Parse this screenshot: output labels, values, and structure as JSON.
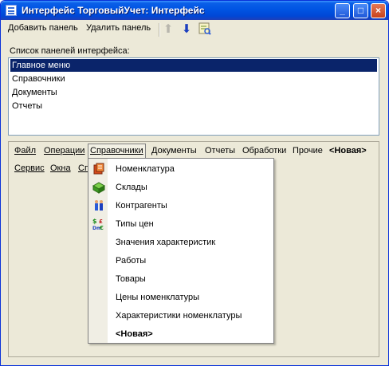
{
  "window": {
    "title": "Интерфейс ТорговыйУчет: Интерфейс"
  },
  "caption_buttons": {
    "minimize": "_",
    "maximize": "□",
    "close": "×"
  },
  "toolbar": {
    "add_panel": "Добавить панель",
    "remove_panel": "Удалить панель",
    "icons": [
      "up-arrow-icon",
      "down-arrow-icon",
      "properties-icon"
    ]
  },
  "panel_list": {
    "label": "Список панелей интерфейса:",
    "items": [
      "Главное меню",
      "Справочники",
      "Документы",
      "Отчеты"
    ],
    "selected": "Главное меню"
  },
  "menubar": {
    "row1": [
      "Файл",
      "Операции",
      "Справочники",
      "Документы",
      "Отчеты",
      "Обработки",
      "Прочие",
      "<Новая>"
    ],
    "row2": [
      "Сервис",
      "Окна",
      "Сп"
    ]
  },
  "dropdown": {
    "items": [
      "Номенклатура",
      "Склады",
      "Контрагенты",
      "Типы цен",
      "Значения характеристик",
      "Работы",
      "Товары",
      "Цены номенклатуры",
      "Характеристики номенклатуры",
      "<Новая>"
    ]
  },
  "colors": {
    "selection": "#0a246a",
    "titlebar": "#0054e3",
    "window_bg": "#ece9d8"
  }
}
